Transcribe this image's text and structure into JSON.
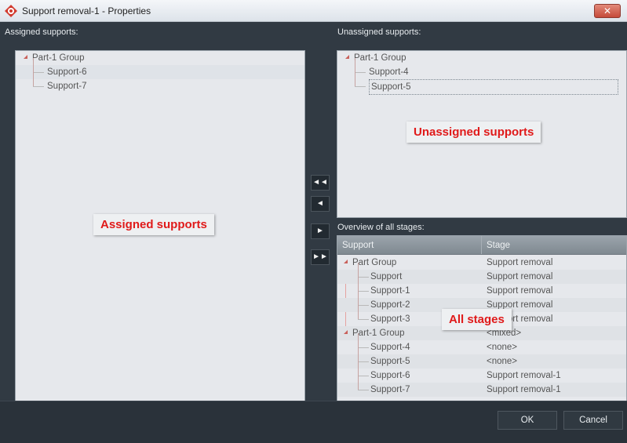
{
  "window": {
    "title": "Support removal-1 - Properties",
    "close_label": "✕"
  },
  "assigned": {
    "label": "Assigned supports:",
    "group": "Part-1 Group",
    "items": [
      "Support-6",
      "Support-7"
    ],
    "overlay": "Assigned supports"
  },
  "unassigned": {
    "label": "Unassigned supports:",
    "group": "Part-1 Group",
    "items": [
      "Support-4",
      "Support-5"
    ],
    "overlay": "Unassigned supports"
  },
  "arrows": {
    "all_left": "◄◄",
    "left": "◄",
    "right": "►",
    "all_right": "►►"
  },
  "overview": {
    "label": "Overview of all stages:",
    "columns": [
      "Support",
      "Stage"
    ],
    "overlay": "All stages",
    "rows": [
      {
        "support": "Part Group",
        "stage": "Support removal"
      },
      {
        "support": "Support",
        "stage": "Support removal"
      },
      {
        "support": "Support-1",
        "stage": "Support removal"
      },
      {
        "support": "Support-2",
        "stage": "Support removal"
      },
      {
        "support": "Support-3",
        "stage": "Support removal"
      },
      {
        "support": "Part-1 Group",
        "stage": "<mixed>"
      },
      {
        "support": "Support-4",
        "stage": "<none>"
      },
      {
        "support": "Support-5",
        "stage": "<none>"
      },
      {
        "support": "Support-6",
        "stage": "Support removal-1"
      },
      {
        "support": "Support-7",
        "stage": "Support removal-1"
      }
    ]
  },
  "buttons": {
    "ok": "OK",
    "cancel": "Cancel"
  }
}
